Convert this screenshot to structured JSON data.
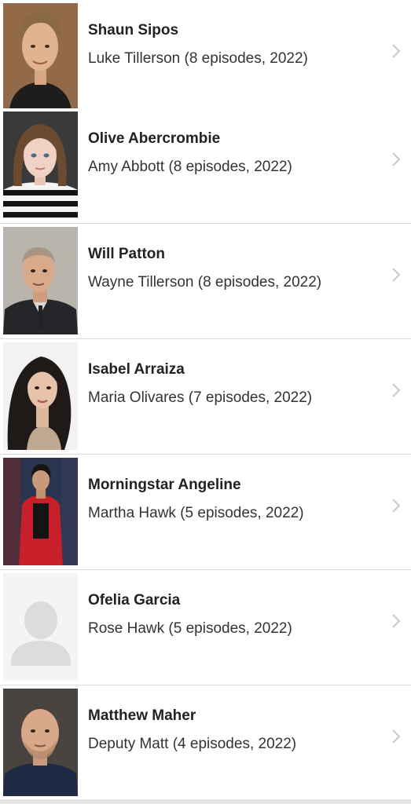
{
  "cast": [
    {
      "name": "Shaun Sipos",
      "role": "Luke Tillerson (8 episodes, 2022)",
      "photo_bg": "#7a5a40",
      "skin": "#e2b38f",
      "hair": "#8a6a45",
      "shirt": "#1d1d1d"
    },
    {
      "name": "Olive Abercrombie",
      "role": "Amy Abbott (8 episodes, 2022)",
      "photo_bg": "#3a3a3a",
      "skin": "#f0d2c4",
      "hair": "#6b4a30",
      "shirt": "#141414"
    },
    {
      "name": "Will Patton",
      "role": "Wayne Tillerson (8 episodes, 2022)",
      "photo_bg": "#c9c5bc",
      "skin": "#d8a98a",
      "hair": "#9a8a7a",
      "shirt": "#24262a"
    },
    {
      "name": "Isabel Arraiza",
      "role": "Maria Olivares (7 episodes, 2022)",
      "photo_bg": "#f2f2f2",
      "skin": "#e6c2a8",
      "hair": "#1f1a18",
      "shirt": "#bfa890"
    },
    {
      "name": "Morningstar Angeline",
      "role": "Martha Hawk (5 episodes, 2022)",
      "photo_bg": "#2a3550",
      "skin": "#c99a7a",
      "hair": "#1a1414",
      "shirt": "#c8202a"
    },
    {
      "name": "Ofelia Garcia",
      "role": "Rose Hawk (5 episodes, 2022)",
      "photo_bg": "#f4f4f4",
      "skin": "#dcdcdc",
      "hair": "#dcdcdc",
      "shirt": "#dcdcdc"
    },
    {
      "name": "Matthew Maher",
      "role": "Deputy Matt (4 episodes, 2022)",
      "photo_bg": "#4a4440",
      "skin": "#d9a88a",
      "hair": "#b48a6a",
      "shirt": "#1e2a44"
    }
  ]
}
